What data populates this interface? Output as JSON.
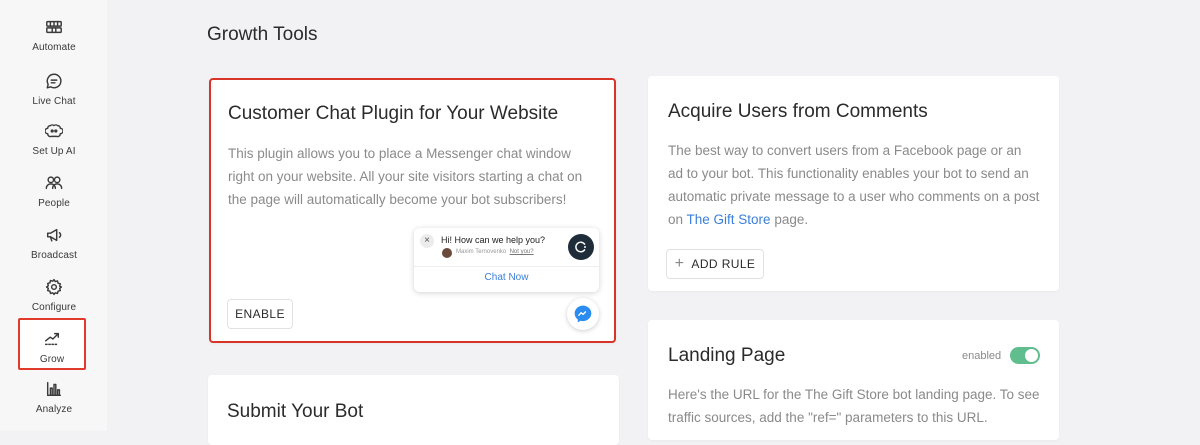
{
  "sidebar": {
    "items": [
      {
        "label": "Automate",
        "icon": "automate-icon"
      },
      {
        "label": "Live Chat",
        "icon": "chat-bubble-icon"
      },
      {
        "label": "Set Up AI",
        "icon": "ai-brain-icon"
      },
      {
        "label": "People",
        "icon": "people-icon"
      },
      {
        "label": "Broadcast",
        "icon": "megaphone-icon"
      },
      {
        "label": "Configure",
        "icon": "gear-icon"
      },
      {
        "label": "Grow",
        "icon": "grow-chart-icon",
        "active": true
      },
      {
        "label": "Analyze",
        "icon": "bar-chart-icon"
      }
    ]
  },
  "page": {
    "title": "Growth Tools"
  },
  "cards": {
    "chat_plugin": {
      "title": "Customer Chat Plugin for Your Website",
      "description": "This plugin allows you to place a Messenger chat window right on your website. All your site visitors starting a chat on the page will automatically become your bot subscribers!",
      "enable_label": "ENABLE",
      "preview": {
        "greeting": "Hi! How can we help you?",
        "agent_name": "Maxim Ternovenko",
        "not_you": "Not you?",
        "chat_now": "Chat Now",
        "close": "×"
      }
    },
    "acquire": {
      "title": "Acquire Users from Comments",
      "description_before": "The best way to convert users from a Facebook page or an ad to your bot. This functionality enables your bot to send an automatic private message to a user who comments on a post on ",
      "page_link": "The Gift Store",
      "description_after": " page.",
      "add_rule_label": "ADD RULE",
      "add_rule_icon": "+"
    },
    "landing": {
      "title": "Landing Page",
      "toggle_label": "enabled",
      "toggle_on": true,
      "description": "Here's the URL for the The Gift Store bot landing page. To see traffic sources, add the \"ref=\" parameters to this URL."
    },
    "submit": {
      "title": "Submit Your Bot"
    }
  },
  "colors": {
    "accent_blue": "#3b7fd9",
    "highlight_red": "#d8352a",
    "toggle_green": "#5fbd8e",
    "background": "#f2f1f3"
  }
}
